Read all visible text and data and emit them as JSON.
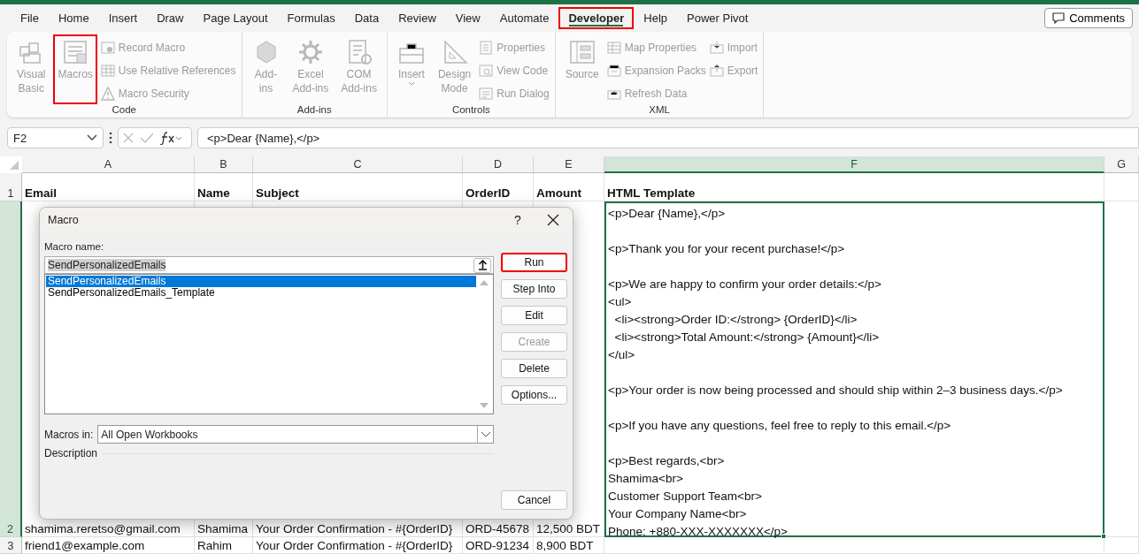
{
  "menu_tabs": [
    {
      "label": "File",
      "selected": false,
      "highlighted": false
    },
    {
      "label": "Home",
      "selected": false,
      "highlighted": false
    },
    {
      "label": "Insert",
      "selected": false,
      "highlighted": false
    },
    {
      "label": "Draw",
      "selected": false,
      "highlighted": false
    },
    {
      "label": "Page Layout",
      "selected": false,
      "highlighted": false
    },
    {
      "label": "Formulas",
      "selected": false,
      "highlighted": false
    },
    {
      "label": "Data",
      "selected": false,
      "highlighted": false
    },
    {
      "label": "Review",
      "selected": false,
      "highlighted": false
    },
    {
      "label": "View",
      "selected": false,
      "highlighted": false
    },
    {
      "label": "Automate",
      "selected": false,
      "highlighted": false
    },
    {
      "label": "Developer",
      "selected": true,
      "highlighted": true
    },
    {
      "label": "Help",
      "selected": false,
      "highlighted": false
    },
    {
      "label": "Power Pivot",
      "selected": false,
      "highlighted": false
    }
  ],
  "comments_button": "Comments",
  "ribbon_groups": [
    {
      "label": "Code",
      "items": [
        {
          "kind": "large",
          "label": "Visual\nBasic",
          "disabled": true,
          "highlighted": false
        },
        {
          "kind": "large",
          "label": "Macros",
          "disabled": true,
          "highlighted": true
        },
        {
          "kind": "small",
          "label": "Record Macro",
          "disabled": true,
          "highlighted": false
        },
        {
          "kind": "small",
          "label": "Use Relative References",
          "disabled": true,
          "highlighted": false
        },
        {
          "kind": "small",
          "label": "Macro Security",
          "disabled": true,
          "highlighted": false
        }
      ]
    },
    {
      "label": "Add-ins",
      "items": [
        {
          "kind": "large",
          "label": "Add-\nins",
          "disabled": true,
          "highlighted": false
        },
        {
          "kind": "large",
          "label": "Excel\nAdd-ins",
          "disabled": true,
          "highlighted": false
        },
        {
          "kind": "large",
          "label": "COM\nAdd-ins",
          "disabled": true,
          "highlighted": false
        }
      ]
    },
    {
      "label": "Controls",
      "items": [
        {
          "kind": "large",
          "label": "Insert",
          "disabled": true,
          "highlighted": false,
          "dropdown": true
        },
        {
          "kind": "large",
          "label": "Design\nMode",
          "disabled": true,
          "highlighted": false
        },
        {
          "kind": "small",
          "label": "Properties",
          "disabled": true,
          "highlighted": false
        },
        {
          "kind": "small",
          "label": "View Code",
          "disabled": true,
          "highlighted": false
        },
        {
          "kind": "small",
          "label": "Run Dialog",
          "disabled": true,
          "highlighted": false
        }
      ]
    },
    {
      "label": "XML",
      "items": [
        {
          "kind": "large",
          "label": "Source",
          "disabled": true,
          "highlighted": false
        },
        {
          "kind": "small",
          "label": "Map Properties",
          "disabled": true,
          "highlighted": false
        },
        {
          "kind": "small",
          "label": "Expansion Packs",
          "disabled": true,
          "highlighted": false
        },
        {
          "kind": "small",
          "label": "Refresh Data",
          "disabled": true,
          "highlighted": false
        },
        {
          "kind": "small",
          "label": "Import",
          "disabled": true,
          "highlighted": false
        },
        {
          "kind": "small",
          "label": "Export",
          "disabled": true,
          "highlighted": false
        }
      ]
    }
  ],
  "formula_bar": {
    "name_box": "F2",
    "formula": "<p>Dear {Name},</p>"
  },
  "sheet": {
    "columns": [
      {
        "label": "A",
        "selected": false
      },
      {
        "label": "B",
        "selected": false
      },
      {
        "label": "C",
        "selected": false
      },
      {
        "label": "D",
        "selected": false
      },
      {
        "label": "E",
        "selected": false
      },
      {
        "label": "F",
        "selected": true
      },
      {
        "label": "G",
        "selected": false
      }
    ],
    "rows": [
      {
        "number": "1",
        "selected": false,
        "cells": [
          {
            "text": "Email",
            "selected": false
          },
          {
            "text": "Name",
            "selected": false
          },
          {
            "text": "Subject",
            "selected": false
          },
          {
            "text": "OrderID",
            "selected": false
          },
          {
            "text": "Amount",
            "selected": false
          },
          {
            "text": "HTML Template",
            "selected": false
          }
        ]
      },
      {
        "number": "2",
        "selected": true,
        "cells": [
          {
            "text": "shamima.reretso@gmail.com",
            "selected": false
          },
          {
            "text": "Shamima",
            "selected": false
          },
          {
            "text": "Your Order Confirmation - #{OrderID}",
            "selected": false
          },
          {
            "text": "ORD-45678",
            "selected": false
          },
          {
            "text": "12,500 BDT",
            "selected": false
          },
          {
            "text": "<p>Dear {Name},</p>\n\n<p>Thank you for your recent purchase!</p>\n\n<p>We are happy to confirm your order details:</p>\n<ul>\n  <li><strong>Order ID:</strong> {OrderID}</li>\n  <li><strong>Total Amount:</strong> {Amount}</li>\n</ul>\n\n<p>Your order is now being processed and should ship within 2–3 business days.</p>\n\n<p>If you have any questions, feel free to reply to this email.</p>\n\n<p>Best regards,<br>\nShamima<br>\nCustomer Support Team<br>\nYour Company Name<br>\nPhone: +880-XXX-XXXXXXX</p>",
            "selected": true
          }
        ]
      },
      {
        "number": "3",
        "selected": false,
        "cells": [
          {
            "text": "friend1@example.com",
            "selected": false
          },
          {
            "text": "Rahim",
            "selected": false
          },
          {
            "text": "Your Order Confirmation - #{OrderID}",
            "selected": false
          },
          {
            "text": "ORD-91234",
            "selected": false
          },
          {
            "text": "8,900 BDT",
            "selected": false
          }
        ]
      }
    ]
  },
  "dialog": {
    "title": "Macro",
    "help": "?",
    "macro_name_label": "Macro name:",
    "macro_name_value": "SendPersonalizedEmails",
    "macros": [
      {
        "label": "SendPersonalizedEmails",
        "selected": true
      },
      {
        "label": "SendPersonalizedEmails_Template",
        "selected": false
      }
    ],
    "buttons": [
      {
        "label": "Run",
        "disabled": false,
        "highlighted": true
      },
      {
        "label": "Step Into",
        "disabled": false,
        "highlighted": false
      },
      {
        "label": "Edit",
        "disabled": false,
        "highlighted": false
      },
      {
        "label": "Create",
        "disabled": true,
        "highlighted": false
      },
      {
        "label": "Delete",
        "disabled": false,
        "highlighted": false
      },
      {
        "label": "Options...",
        "disabled": false,
        "highlighted": false
      }
    ],
    "macros_in_label": "Macros in:",
    "macros_in_value": "All Open Workbooks",
    "description_label": "Description",
    "cancel_button": "Cancel"
  }
}
